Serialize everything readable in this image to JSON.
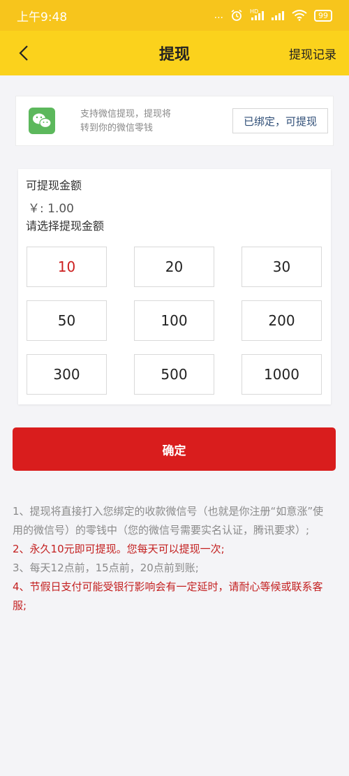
{
  "status_bar": {
    "time": "上午9:48",
    "dots": "...",
    "signal_label": "HD",
    "battery": "99"
  },
  "nav": {
    "title": "提现",
    "right_link": "提现记录"
  },
  "wechat": {
    "line1": "支持微信提现，提现将",
    "line2": "转到你的微信零钱",
    "bind_label": "已绑定，可提现"
  },
  "amount": {
    "available_label": "可提现金额",
    "balance": "￥: 1.00",
    "choose_label": "请选择提现金额",
    "options": [
      "10",
      "20",
      "30",
      "50",
      "100",
      "200",
      "300",
      "500",
      "1000"
    ],
    "selected": "10"
  },
  "confirm_label": "确定",
  "notes": [
    {
      "num": "1、",
      "text": "提现将直接打入您绑定的收款微信号（也就是你注册“如意涨”使用的微信号）的零钱中（您的微信号需要实名认证，腾讯要求）;",
      "highlight": false
    },
    {
      "num": "2、",
      "text": "永久10元即可提现。您每天可以提现一次;",
      "highlight": true
    },
    {
      "num": "3、",
      "text": "每天12点前，15点前，20点前到账;",
      "highlight": false
    },
    {
      "num": "4、",
      "text": "节假日支付可能受银行影响会有一定延时，请耐心等候或联系客服;",
      "highlight": true
    }
  ],
  "colors": {
    "status_bar": "#f7c51c",
    "nav_bar": "#fbd21c",
    "wechat_green": "#5cb85c",
    "primary_red": "#d91d1d",
    "selected_red": "#cc1f1f",
    "bind_text": "#2f4e77"
  }
}
